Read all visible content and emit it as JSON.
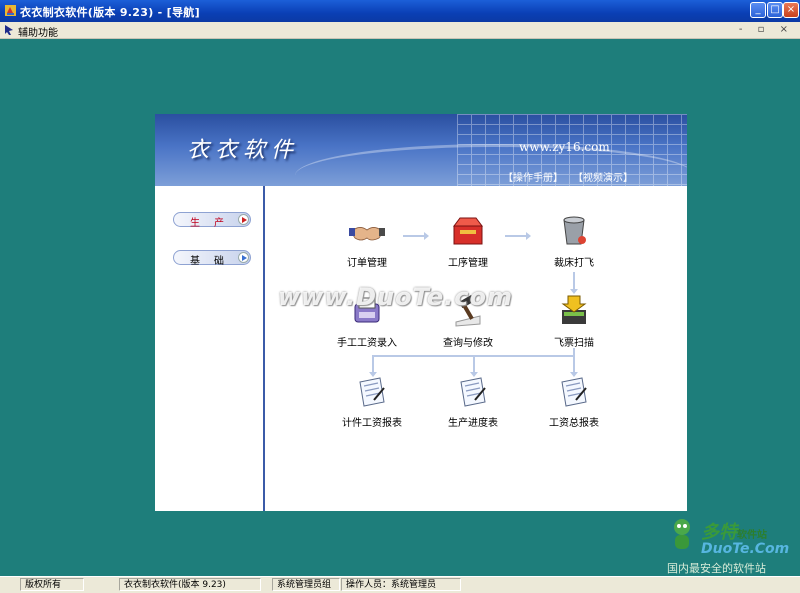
{
  "window": {
    "title": "衣衣制衣软件(版本 9.23)  - [导航]",
    "minimize": "_",
    "maximize": "□",
    "close": "×"
  },
  "menubar": {
    "items": [
      "辅助功能"
    ],
    "mdi_controls": "- ▫ ×"
  },
  "banner": {
    "logo_text": "衣衣软件",
    "url": "www.zy16.com",
    "manual_link": "【操作手册】",
    "video_link": "【视频演示】"
  },
  "sidebar": {
    "buttons": [
      {
        "label": "生产",
        "color": "#c0001c",
        "active": true
      },
      {
        "label": "基础",
        "color": "#000000",
        "active": false
      }
    ]
  },
  "workflow": {
    "nodes": [
      {
        "id": "order",
        "label": "订单管理",
        "icon": "handshake-icon"
      },
      {
        "id": "process",
        "label": "工序管理",
        "icon": "toolbox-icon"
      },
      {
        "id": "cutting",
        "label": "裁床打飞",
        "icon": "bucket-icon"
      },
      {
        "id": "manual_wage",
        "label": "手工工资录入",
        "icon": "scanner-icon"
      },
      {
        "id": "query",
        "label": "查询与修改",
        "icon": "gavel-icon"
      },
      {
        "id": "ticket_scan",
        "label": "飞票扫描",
        "icon": "scan-arrow-icon"
      },
      {
        "id": "piece_report",
        "label": "计件工资报表",
        "icon": "report-icon"
      },
      {
        "id": "progress_report",
        "label": "生产进度表",
        "icon": "report-icon"
      },
      {
        "id": "wage_report",
        "label": "工资总报表",
        "icon": "report-icon"
      }
    ]
  },
  "watermarks": {
    "center": "www.DuoTe.com",
    "corner_title": "多特",
    "corner_sub": "软件站",
    "corner_url": "DuoTe.Com",
    "corner_tagline": "国内最安全的软件站"
  },
  "statusbar": {
    "copyright": "版权所有",
    "app_version": "衣衣制衣软件(版本 9.23)",
    "group": "系统管理员组",
    "operator": "操作人员：系统管理员"
  },
  "colors": {
    "desktop": "#1e7e7b",
    "banner": "#3b5ba8",
    "accent_red": "#c0001c"
  }
}
